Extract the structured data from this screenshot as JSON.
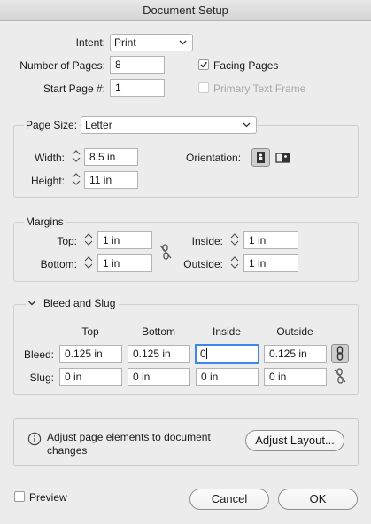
{
  "window": {
    "title": "Document Setup"
  },
  "intent": {
    "label": "Intent:",
    "value": "Print"
  },
  "pages": {
    "number_label": "Number of Pages:",
    "number_value": "8",
    "start_label": "Start Page #:",
    "start_value": "1",
    "facing_label": "Facing Pages",
    "facing_checked": true,
    "primary_label": "Primary Text Frame",
    "primary_checked": false
  },
  "page_size": {
    "label": "Page Size:",
    "value": "Letter",
    "width_label": "Width:",
    "width_value": "8.5 in",
    "height_label": "Height:",
    "height_value": "11 in",
    "orientation_label": "Orientation:"
  },
  "margins": {
    "legend": "Margins",
    "top_label": "Top:",
    "top_value": "1 in",
    "bottom_label": "Bottom:",
    "bottom_value": "1 in",
    "inside_label": "Inside:",
    "inside_value": "1 in",
    "outside_label": "Outside:",
    "outside_value": "1 in"
  },
  "bleed_slug": {
    "legend": "Bleed and Slug",
    "headers": [
      "Top",
      "Bottom",
      "Inside",
      "Outside"
    ],
    "bleed_label": "Bleed:",
    "bleed_values": [
      "0.125 in",
      "0.125 in",
      "0",
      "0.125 in"
    ],
    "slug_label": "Slug:",
    "slug_values": [
      "0 in",
      "0 in",
      "0 in",
      "0 in"
    ]
  },
  "adjust": {
    "message": "Adjust page elements to document changes",
    "button_label": "Adjust Layout..."
  },
  "footer": {
    "preview_label": "Preview",
    "preview_checked": false,
    "cancel_label": "Cancel",
    "ok_label": "OK"
  },
  "colors": {
    "focus": "#3b88e8",
    "background": "#ececec"
  }
}
